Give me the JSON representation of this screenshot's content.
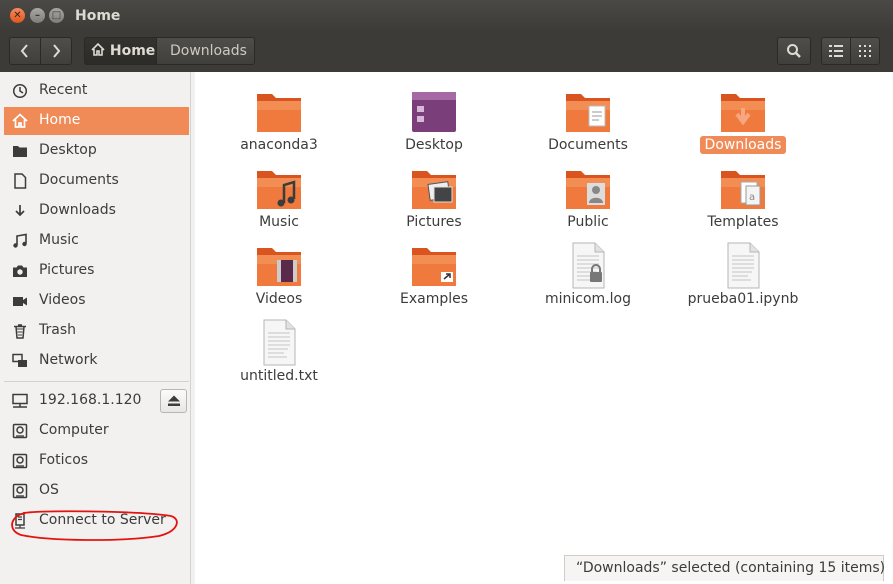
{
  "window": {
    "title": "Home"
  },
  "toolbar": {
    "back_label": "‹",
    "forward_label": "›",
    "crumbs": [
      "Home",
      "Downloads"
    ]
  },
  "sidebar": {
    "items": [
      {
        "label": "Recent",
        "icon": "clock-icon"
      },
      {
        "label": "Home",
        "icon": "home-icon",
        "active": true
      },
      {
        "label": "Desktop",
        "icon": "folder-icon"
      },
      {
        "label": "Documents",
        "icon": "document-icon"
      },
      {
        "label": "Downloads",
        "icon": "download-icon"
      },
      {
        "label": "Music",
        "icon": "music-icon"
      },
      {
        "label": "Pictures",
        "icon": "camera-icon"
      },
      {
        "label": "Videos",
        "icon": "video-icon"
      },
      {
        "label": "Trash",
        "icon": "trash-icon"
      },
      {
        "label": "Network",
        "icon": "network-icon"
      }
    ],
    "devices": [
      {
        "label": "192.168.1.120",
        "icon": "network-drive-icon"
      },
      {
        "label": "Computer",
        "icon": "drive-icon"
      },
      {
        "label": "Foticos",
        "icon": "drive-icon"
      },
      {
        "label": "OS",
        "icon": "drive-icon"
      },
      {
        "label": "Connect to Server",
        "icon": "server-icon"
      }
    ]
  },
  "files": [
    {
      "name": "anaconda3",
      "kind": "folder"
    },
    {
      "name": "Desktop",
      "kind": "desktop"
    },
    {
      "name": "Documents",
      "kind": "folder-documents"
    },
    {
      "name": "Downloads",
      "kind": "folder-downloads",
      "selected": true
    },
    {
      "name": "Music",
      "kind": "folder-music"
    },
    {
      "name": "Pictures",
      "kind": "folder-pictures"
    },
    {
      "name": "Public",
      "kind": "folder-public"
    },
    {
      "name": "Templates",
      "kind": "folder-templates"
    },
    {
      "name": "Videos",
      "kind": "folder-videos"
    },
    {
      "name": "Examples",
      "kind": "folder-link"
    },
    {
      "name": "minicom.log",
      "kind": "file-locked"
    },
    {
      "name": "prueba01.ipynb",
      "kind": "file"
    },
    {
      "name": "untitled.txt",
      "kind": "file"
    }
  ],
  "status": {
    "text": "“Downloads” selected  (containing 15 items)"
  },
  "colors": {
    "accent": "#f08b58",
    "titlebar": "#3c3b37",
    "folder": "#e9692c"
  }
}
